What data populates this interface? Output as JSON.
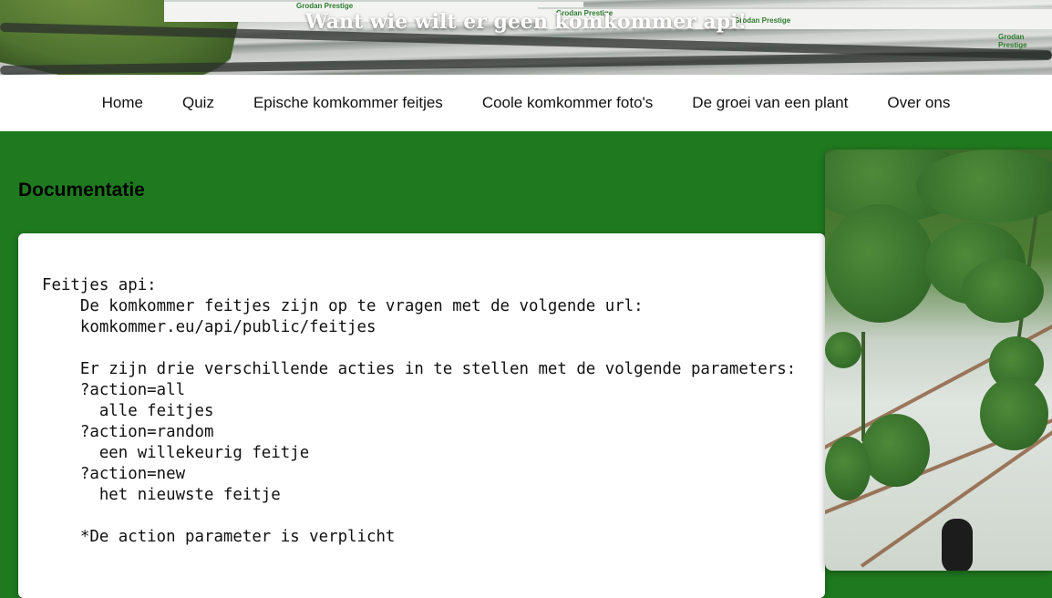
{
  "banner": {
    "title": "Want wie wilt er geen komkommer api!",
    "slab_labels": [
      "Grodan Prestige",
      "Grodan Prestige",
      "Grodan Prestige",
      "Grodan Prestige"
    ]
  },
  "nav": {
    "items": [
      {
        "label": "Home"
      },
      {
        "label": "Quiz"
      },
      {
        "label": "Epische komkommer feitjes"
      },
      {
        "label": "Coole komkommer foto's"
      },
      {
        "label": "De groei van een plant"
      },
      {
        "label": "Over ons"
      }
    ]
  },
  "main": {
    "heading": "Documentatie",
    "code": "Feitjes api:\n    De komkommer feitjes zijn op te vragen met de volgende url:\n    komkommer.eu/api/public/feitjes\n\n    Er zijn drie verschillende acties in te stellen met de volgende parameters:\n    ?action=all\n      alle feitjes\n    ?action=random\n      een willekeurig feitje\n    ?action=new\n      het nieuwste feitje\n\n    *De action parameter is verplicht"
  },
  "colors": {
    "page_background": "#1f7a1f",
    "nav_background": "#ffffff",
    "card_background": "#ffffff"
  }
}
